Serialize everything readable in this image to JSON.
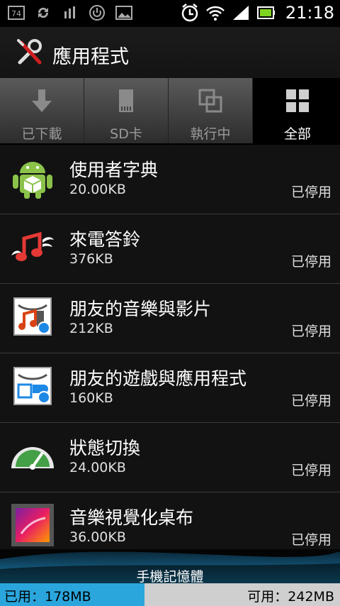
{
  "status_bar": {
    "battery_notice": "74",
    "time": "21:18"
  },
  "header": {
    "title": "應用程式"
  },
  "tabs": [
    {
      "label": "已下載",
      "selected": false
    },
    {
      "label": "SD卡",
      "selected": false
    },
    {
      "label": "執行中",
      "selected": false
    },
    {
      "label": "全部",
      "selected": true
    }
  ],
  "apps": [
    {
      "name": "使用者字典",
      "size": "20.00KB",
      "status": "已停用",
      "icon": "android-box-icon"
    },
    {
      "name": "來電答鈴",
      "size": "376KB",
      "status": "已停用",
      "icon": "winged-music-note-icon"
    },
    {
      "name": "朋友的音樂與影片",
      "size": "212KB",
      "status": "已停用",
      "icon": "friends-music-icon"
    },
    {
      "name": "朋友的遊戲與應用程式",
      "size": "160KB",
      "status": "已停用",
      "icon": "friends-games-icon"
    },
    {
      "name": "狀態切換",
      "size": "24.00KB",
      "status": "已停用",
      "icon": "gauge-icon"
    },
    {
      "name": "音樂視覺化桌布",
      "size": "36.00KB",
      "status": "已停用",
      "icon": "music-visualizer-icon"
    }
  ],
  "storage": {
    "label": "手機記憶體",
    "used": "已用：178MB",
    "free": "可用：242MB",
    "used_fraction": 0.424
  },
  "colors": {
    "accent": "#2aa6dd"
  }
}
